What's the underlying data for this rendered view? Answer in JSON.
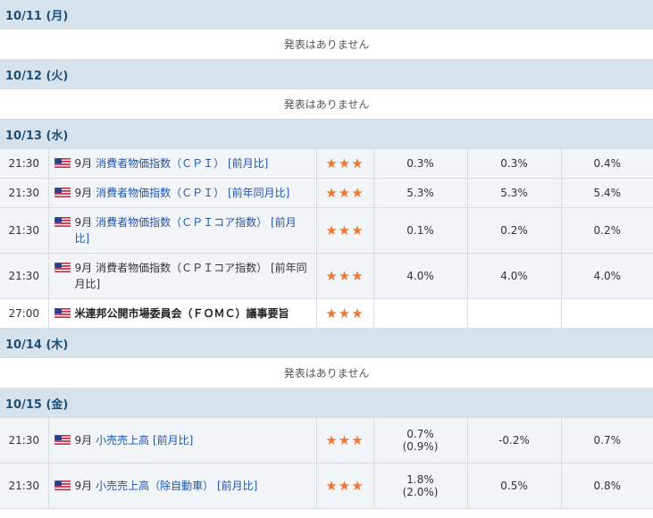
{
  "days": [
    {
      "date": "10/11 (月)",
      "note": "発表はありません",
      "events": []
    },
    {
      "date": "10/12 (火)",
      "note": "発表はありません",
      "events": []
    },
    {
      "date": "10/13 (水)",
      "note": "",
      "events": [
        {
          "time": "21:30",
          "period": "9月",
          "title": "消費者物価指数（ＣＰＩ） [前月比]",
          "style": "link",
          "stars": "★★★",
          "result": "0.3%",
          "result_sub": "",
          "forecast": "0.3%",
          "previous": "0.4%"
        },
        {
          "time": "21:30",
          "period": "9月",
          "title": "消費者物価指数（ＣＰＩ） [前年同月比]",
          "style": "link",
          "stars": "★★★",
          "result": "5.3%",
          "result_sub": "",
          "forecast": "5.3%",
          "previous": "5.4%"
        },
        {
          "time": "21:30",
          "period": "9月",
          "title": "消費者物価指数（ＣＰＩコア指数） [前月比]",
          "style": "link",
          "stars": "★★★",
          "result": "0.1%",
          "result_sub": "",
          "forecast": "0.2%",
          "previous": "0.2%"
        },
        {
          "time": "21:30",
          "period": "9月",
          "title": "消費者物価指数（ＣＰＩコア指数） [前年同月比]",
          "style": "plain",
          "stars": "★★★",
          "result": "4.0%",
          "result_sub": "",
          "forecast": "4.0%",
          "previous": "4.0%"
        },
        {
          "time": "27:00",
          "period": "",
          "title": "米連邦公開市場委員会（ＦＯＭＣ）議事要旨",
          "style": "bold",
          "stars": "★★★",
          "result": "",
          "result_sub": "",
          "forecast": "",
          "previous": ""
        }
      ]
    },
    {
      "date": "10/14 (木)",
      "note": "発表はありません",
      "events": []
    },
    {
      "date": "10/15 (金)",
      "note": "",
      "events": [
        {
          "time": "21:30",
          "period": "9月",
          "title": "小売売上高 [前月比]",
          "style": "link",
          "stars": "★★★",
          "result": "0.7%",
          "result_sub": "(0.9%)",
          "forecast": "-0.2%",
          "previous": "0.7%"
        },
        {
          "time": "21:30",
          "period": "9月",
          "title": "小売売上高（除自動車） [前月比]",
          "style": "link",
          "stars": "★★★",
          "result": "1.8%",
          "result_sub": "(2.0%)",
          "forecast": "0.5%",
          "previous": "0.8%"
        }
      ]
    }
  ]
}
